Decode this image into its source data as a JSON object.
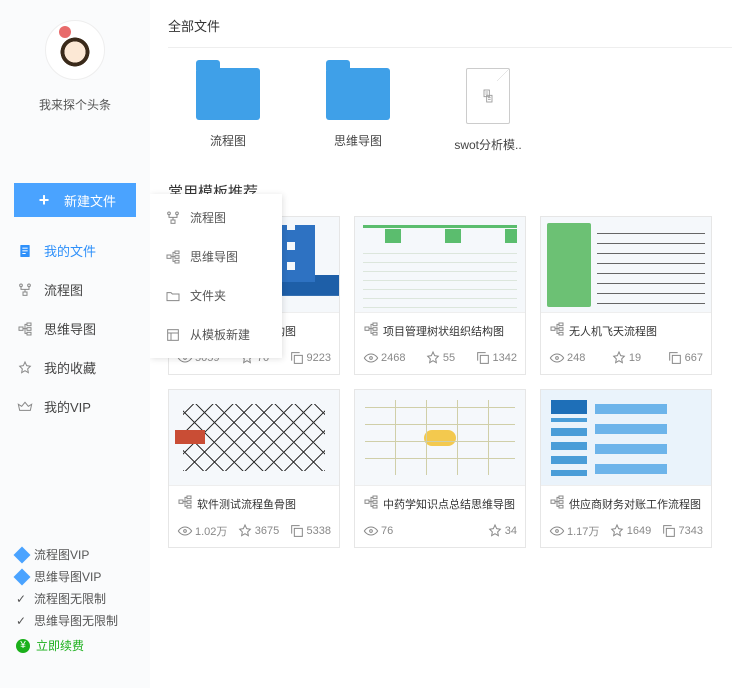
{
  "user": {
    "name": "我来探个头条"
  },
  "newBtn": {
    "label": "新建文件"
  },
  "nav": {
    "items": [
      {
        "label": "我的文件",
        "icon": "file-icon",
        "active": true
      },
      {
        "label": "流程图",
        "icon": "flowchart-icon"
      },
      {
        "label": "思维导图",
        "icon": "mindmap-icon"
      },
      {
        "label": "我的收藏",
        "icon": "star-icon"
      },
      {
        "label": "我的VIP",
        "icon": "crown-icon"
      }
    ]
  },
  "popup": {
    "items": [
      {
        "label": "流程图",
        "icon": "flowchart-icon"
      },
      {
        "label": "思维导图",
        "icon": "mindmap-icon"
      },
      {
        "label": "文件夹",
        "icon": "folder-icon"
      },
      {
        "label": "从模板新建",
        "icon": "template-icon"
      }
    ]
  },
  "vip": {
    "l1": "流程图VIP",
    "l2": "思维导图VIP",
    "l3": "流程图无限制",
    "l4": "思维导图无限制",
    "renew": "立即续费"
  },
  "breadcrumb": "全部文件",
  "folders": [
    {
      "label": "流程图",
      "type": "blue"
    },
    {
      "label": "思维导图",
      "type": "blue"
    },
    {
      "label": "swot分析模..",
      "type": "doc"
    }
  ],
  "templates": {
    "title": "常用模板推荐",
    "items": [
      {
        "title": "公司架构组织结构图",
        "views": "5059",
        "likes": "70",
        "copies": "9223",
        "th": "a"
      },
      {
        "title": "项目管理树状组织结构图",
        "views": "2468",
        "likes": "55",
        "copies": "1342",
        "th": "b"
      },
      {
        "title": "无人机飞天流程图",
        "views": "248",
        "likes": "19",
        "copies": "667",
        "th": "c"
      },
      {
        "title": "软件测试流程鱼骨图",
        "views": "1.02万",
        "likes": "3675",
        "copies": "5338",
        "th": "d"
      },
      {
        "title": "中药学知识点总结思维导图",
        "views": "76",
        "likes": "34",
        "copies": "",
        "th": "e"
      },
      {
        "title": "供应商财务对账工作流程图",
        "views": "1.17万",
        "likes": "1649",
        "copies": "7343",
        "th": "f"
      }
    ]
  }
}
